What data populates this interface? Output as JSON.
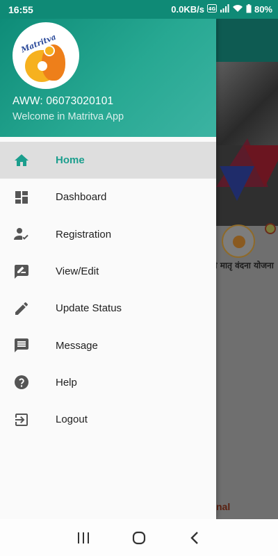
{
  "status_bar": {
    "time": "16:55",
    "network_speed": "0.0KB/s",
    "battery": "80%"
  },
  "drawer": {
    "header": {
      "logo_text": "Matritva",
      "user_id": "AWW: 06073020101",
      "welcome": "Welcome in Matritva App"
    },
    "items": [
      {
        "label": "Home",
        "icon": "home-icon",
        "active": true
      },
      {
        "label": "Dashboard",
        "icon": "dashboard-icon",
        "active": false
      },
      {
        "label": "Registration",
        "icon": "registration-icon",
        "active": false
      },
      {
        "label": "View/Edit",
        "icon": "view-edit-icon",
        "active": false
      },
      {
        "label": "Update Status",
        "icon": "pencil-icon",
        "active": false
      },
      {
        "label": "Message",
        "icon": "message-icon",
        "active": false
      },
      {
        "label": "Help",
        "icon": "help-icon",
        "active": false
      },
      {
        "label": "Logout",
        "icon": "logout-icon",
        "active": false
      }
    ]
  },
  "background": {
    "scheme_text": "श्री मातृ वंदना योजना",
    "bottom_text": "nal"
  },
  "colors": {
    "accent": "#1b9e8d",
    "header_start": "#0e8c78",
    "header_end": "#3cb3a2",
    "icon": "#555555"
  }
}
